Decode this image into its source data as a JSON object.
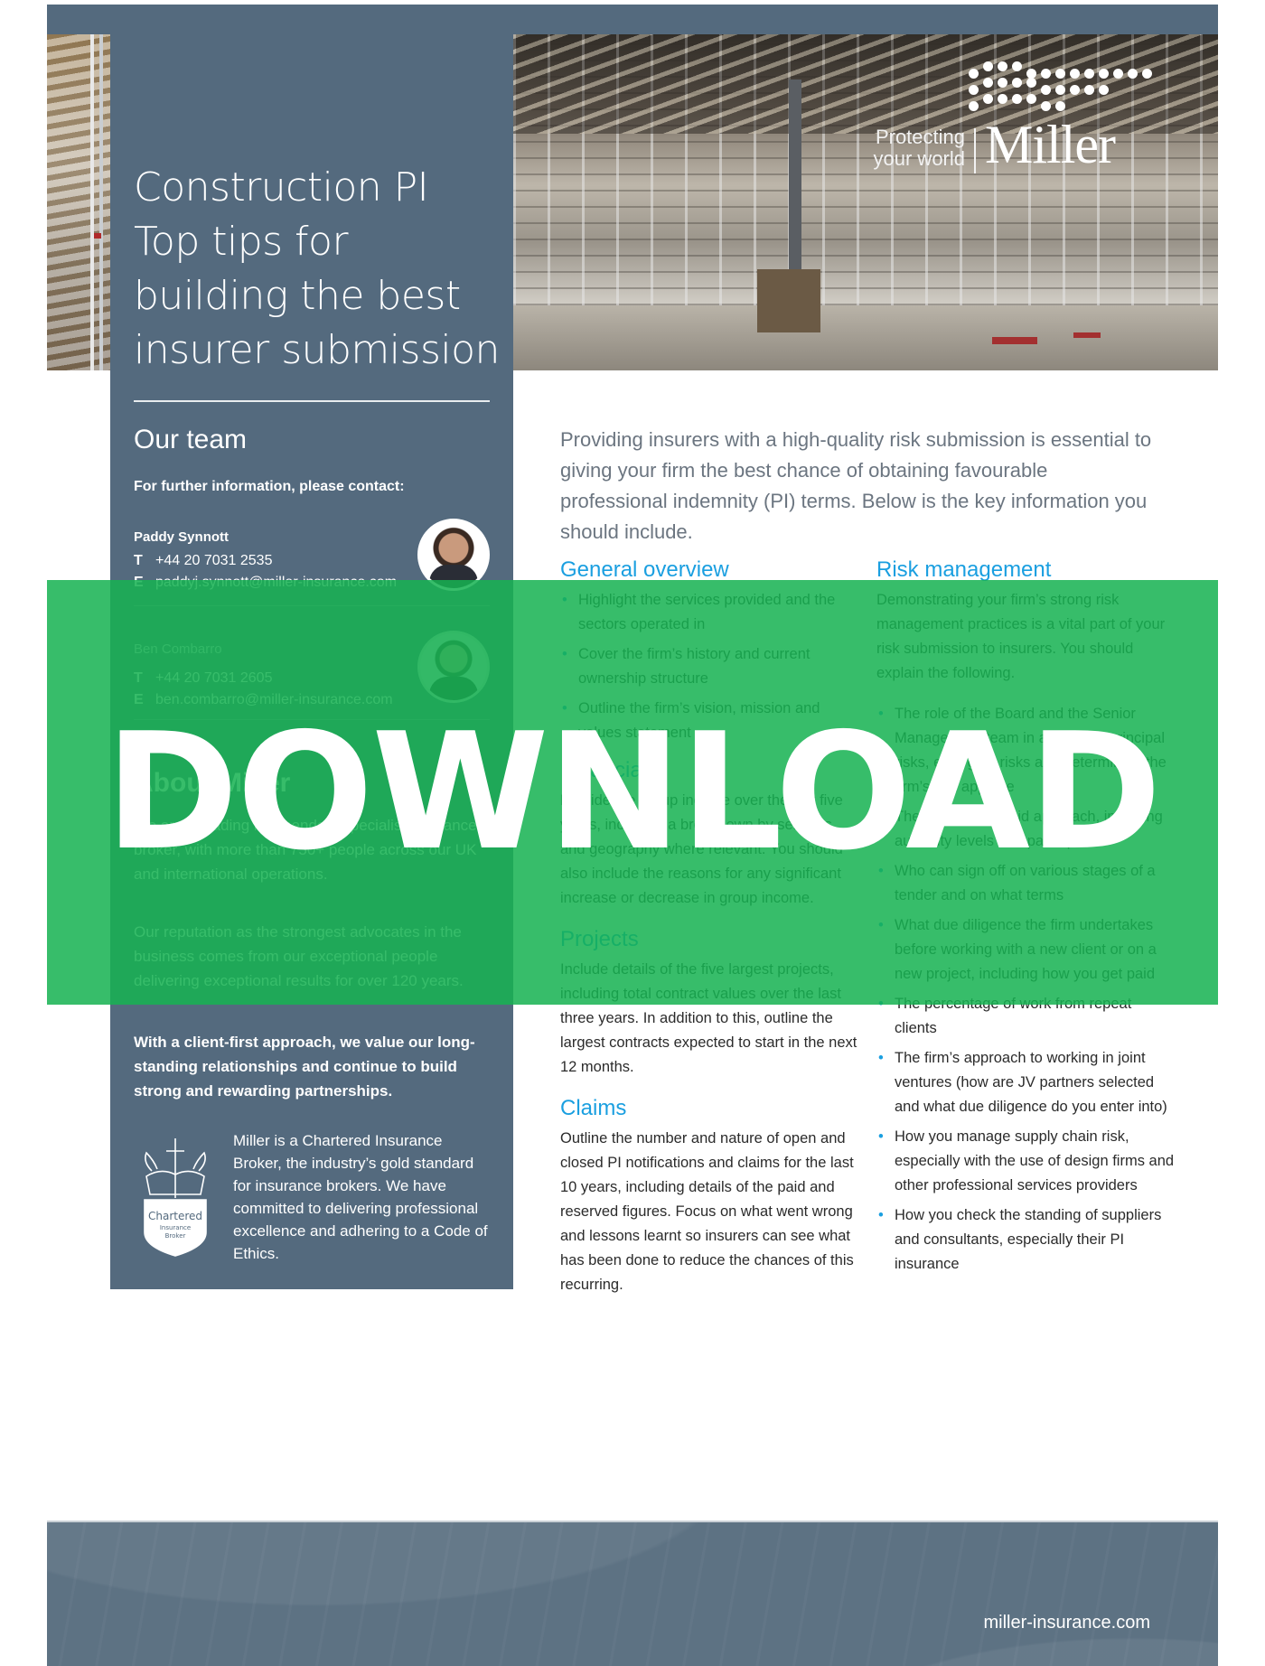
{
  "brand": {
    "tagline_line1": "Protecting",
    "tagline_line2": "your world",
    "wordmark": "Miller",
    "accent_color": "#1a9fe0",
    "panel_color": "#546a7e",
    "overlay_color": "#16b252"
  },
  "sidebar": {
    "title_lines": [
      "Construction PI",
      "Top tips for",
      "building the best",
      "insurer submission"
    ],
    "team": {
      "heading": "Our team",
      "intro": "For further information, please contact:",
      "contacts": [
        {
          "name": "Paddy Synnott",
          "phone_label": "T",
          "phone": "+44 20 7031 2535",
          "email_label": "E",
          "email": "paddyj.synnott@miller-insurance.com"
        },
        {
          "name": "Ben Combarro",
          "phone_label": "T",
          "phone": "+44 20 7031 2605",
          "email_label": "E",
          "email": "ben.combarro@miller-insurance.com"
        }
      ]
    },
    "about": {
      "heading": "About Miller",
      "paragraphs": [
        "We are a leading independent specialist insurance broker, with more than 750+ people across our UK and international operations.",
        "Our reputation as the strongest advocates in the business comes from our exceptional people delivering exceptional results for over 120 years.",
        "With a client-first approach, we value our long-standing relationships and continue to build strong and rewarding partnerships."
      ]
    },
    "chartered": {
      "badge_line1": "Chartered",
      "badge_line2": "Insurance",
      "badge_line3": "Broker",
      "text": "Miller is a Chartered Insurance Broker, the industry’s gold standard for insurance brokers. We have committed to delivering professional excellence and adhering to a Code of Ethics."
    }
  },
  "main": {
    "intro": "Providing insurers with a high-quality risk submission is essential to giving your firm the best chance of obtaining favourable professional indemnity (PI) terms. Below is the key information you should include.",
    "left_column": {
      "general_overview": {
        "heading": "General overview",
        "bullets": [
          "Highlight the services provided and the sectors operated in",
          "Cover the firm’s history and current ownership structure",
          "Outline the firm’s vision, mission and values statement"
        ]
      },
      "financials": {
        "heading": "Financials",
        "text": "Provide the group income over the last five years, including a breakdown by services and geography where relevant. You should also include the reasons for any significant increase or decrease in group income."
      },
      "projects": {
        "heading": "Projects",
        "text": "Include details of the five largest projects, including total contract values over the last three years. In addition to this, outline the largest contracts expected to start in the next 12 months."
      },
      "claims": {
        "heading": "Claims",
        "text": "Outline the number and nature of open and closed PI notifications and claims for the last 10 years, including details of the paid and reserved figures. Focus on what went wrong and lessons learnt so insurers can see what has been done to reduce the chances of this recurring."
      }
    },
    "right_column": {
      "risk_management": {
        "heading": "Risk management",
        "text": "Demonstrating your firm’s strong risk management practices is a vital part of your risk submission to insurers. You should explain the following.",
        "bullets": [
          "The role of the Board and the Senior Management team in assessing principal risks, emerging risks and determining the firm’s risk appetite",
          "The firm’s bid/no-bid approach, including authority levels and participation",
          "Who can sign off on various stages of a tender and on what terms",
          "What due diligence the firm undertakes before working with a new client or on a new project, including how you get paid",
          "The percentage of work from repeat clients",
          "The firm’s approach to working in joint ventures (how are JV partners selected and what due diligence do you enter into)",
          "How you manage supply chain risk, especially with the use of design firms and other professional services providers",
          "How you check the standing of suppliers and consultants, especially their PI insurance"
        ]
      }
    }
  },
  "footer": {
    "url": "miller-insurance.com"
  },
  "overlay": {
    "label": "DOWNLOAD"
  }
}
